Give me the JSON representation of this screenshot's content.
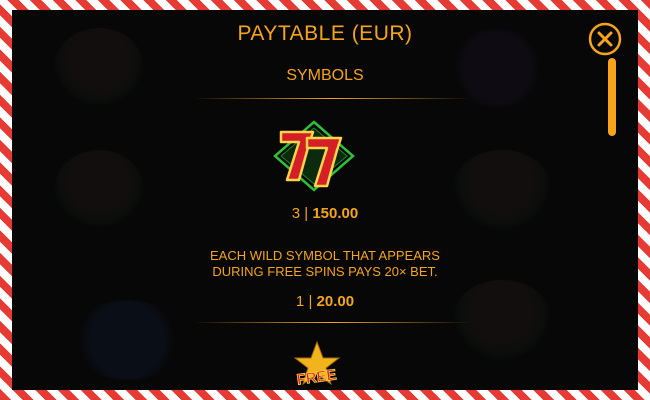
{
  "header": {
    "title": "PAYTABLE  (EUR)",
    "close_icon": "close-icon"
  },
  "section": {
    "title": "SYMBOLS"
  },
  "symbols": [
    {
      "icon": "seven-icon",
      "count": "3",
      "separator": "|",
      "payout": "150.00"
    }
  ],
  "wild": {
    "line1": "EACH WILD SYMBOL THAT APPEARS",
    "line2": "DURING FREE SPINS PAYS 20× BET.",
    "count": "1",
    "separator": "|",
    "payout": "20.00"
  },
  "next_symbol": {
    "icon": "free-spins-icon",
    "label": "FREE"
  },
  "colors": {
    "accent": "#f6a41b",
    "frame_red": "#e63a34",
    "background": "#070708"
  }
}
